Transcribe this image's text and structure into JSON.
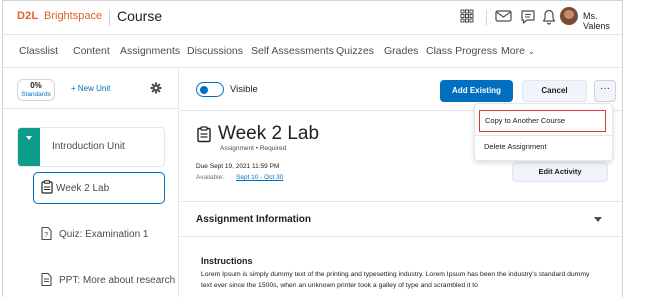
{
  "header": {
    "logo": "D2L",
    "brand": "Brightspace",
    "course": "Course",
    "user_name": "Ms. Valens"
  },
  "nav": {
    "items": [
      "Classlist",
      "Content",
      "Assignments",
      "Discussions",
      "Self Assessments",
      "Quizzes",
      "Grades",
      "Class Progress",
      "More"
    ]
  },
  "sidebar": {
    "progress_value": "0%",
    "progress_label": "Standards",
    "new_unit": "+ New Unit",
    "unit": "Introduction Unit",
    "toc": [
      "Week 2 Lab",
      "Quiz: Examination 1",
      "PPT: More about research"
    ]
  },
  "main": {
    "visible_label": "Visible",
    "add_existing": "Add Existing",
    "cancel": "Cancel",
    "more": "···",
    "title": "Week 2 Lab",
    "meta": "Assignment •  Required",
    "due": "Due Sept 19, 2021 11:59 PM",
    "available_label": "Available:",
    "available_value": "Sept 10 - Oct 30",
    "edit_activity": "Edit Activity",
    "info_title": "Assignment Information",
    "instructions_title": "Instructions",
    "instructions_body": "Lorem Ipsum is simply dummy text of the printing and typesetting industry. Lorem Ipsum has been the industry's standard dummy text ever since the 1500s, when an unknown printer took a galley of type and scrambled it to"
  },
  "dropdown": {
    "items": [
      "Copy to Another Course",
      "Delete Assignment"
    ]
  },
  "colors": {
    "brand_orange": "#e0622a",
    "primary_blue": "#006fbf",
    "unit_green": "#0d9b8a",
    "highlight_red": "#d63c3c"
  },
  "icons": [
    "grid-icon",
    "mail-icon",
    "chat-icon",
    "bell-icon",
    "gear-icon",
    "assignment-icon",
    "quiz-icon",
    "document-icon"
  ]
}
